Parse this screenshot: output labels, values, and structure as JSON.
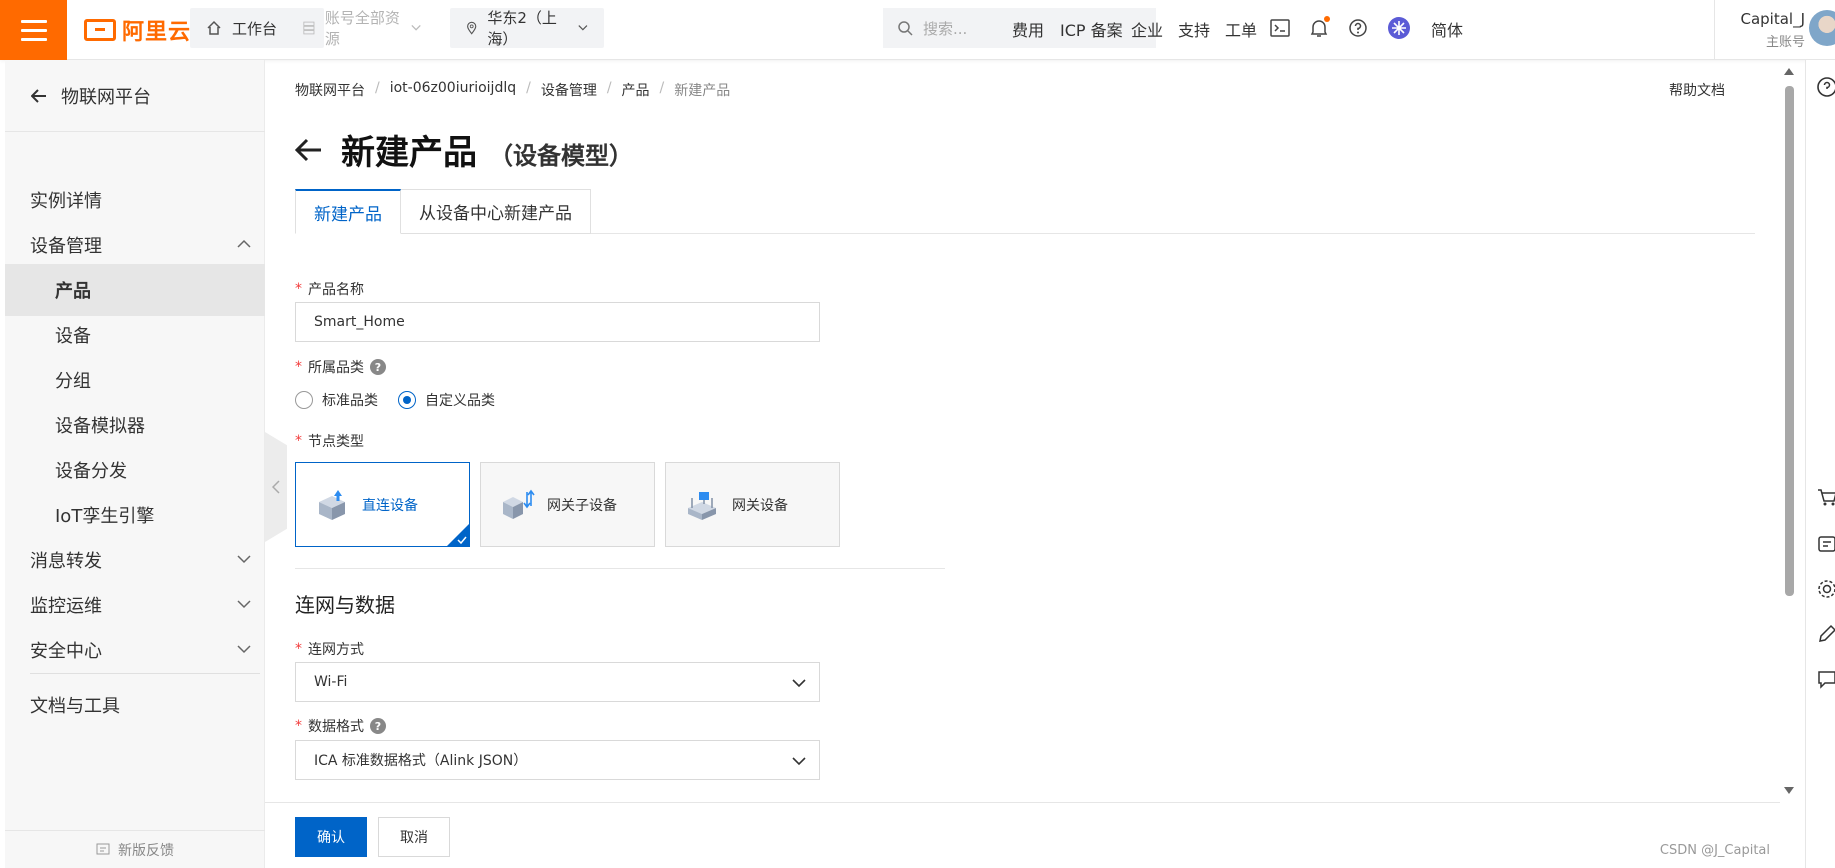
{
  "topbar": {
    "logo_text": "阿里云",
    "workbench": "工作台",
    "resources": "账号全部资源",
    "region": "华东2（上海）",
    "search_placeholder": "搜索...",
    "links": [
      "费用",
      "ICP 备案",
      "企业",
      "支持",
      "工单"
    ],
    "language": "简体",
    "account_name": "Capital_J",
    "account_role": "主账号"
  },
  "sidebar": {
    "back_label": "物联网平台",
    "items": [
      {
        "label": "实例详情"
      },
      {
        "label": "设备管理"
      },
      {
        "label": "产品"
      },
      {
        "label": "设备"
      },
      {
        "label": "分组"
      },
      {
        "label": "设备模拟器"
      },
      {
        "label": "设备分发"
      },
      {
        "label": "IoT孪生引擎"
      },
      {
        "label": "消息转发"
      },
      {
        "label": "监控运维"
      },
      {
        "label": "安全中心"
      },
      {
        "label": "文档与工具"
      }
    ],
    "feedback": "新版反馈"
  },
  "breadcrumb": [
    "物联网平台",
    "iot-06z00iurioijdlq",
    "设备管理",
    "产品",
    "新建产品"
  ],
  "help_doc": "帮助文档",
  "page": {
    "title": "新建产品",
    "subtitle": "（设备模型）"
  },
  "tabs": [
    "新建产品",
    "从设备中心新建产品"
  ],
  "form": {
    "product_name_label": "产品名称",
    "product_name_value": "Smart_Home",
    "category_label": "所属品类",
    "category_options": [
      "标准品类",
      "自定义品类"
    ],
    "category_selected": "自定义品类",
    "node_type_label": "节点类型",
    "node_types": [
      "直连设备",
      "网关子设备",
      "网关设备"
    ],
    "node_type_selected": "直连设备",
    "section_network": "连网与数据",
    "network_label": "连网方式",
    "network_value": "Wi-Fi",
    "data_format_label": "数据格式",
    "data_format_value": "ICA 标准数据格式（Alink JSON）"
  },
  "footer": {
    "confirm": "确认",
    "cancel": "取消",
    "watermark": "CSDN @J_Capital"
  },
  "colors": {
    "brand_orange": "#ff6a00",
    "primary_blue": "#0064c8",
    "required_red": "#f23c3c"
  }
}
